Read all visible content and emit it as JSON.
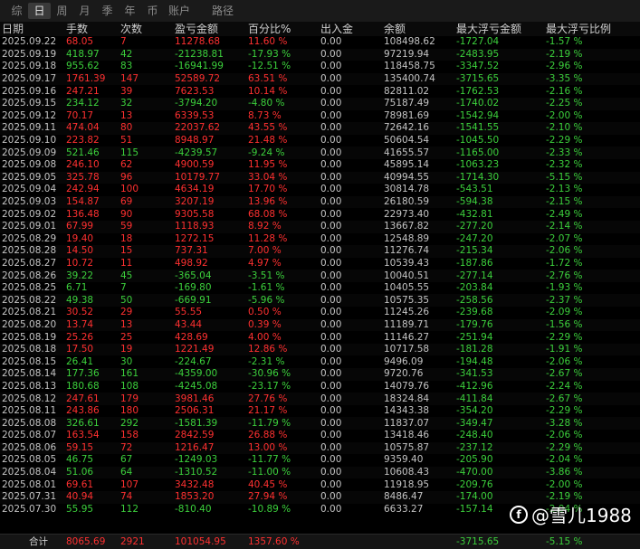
{
  "tabs": [
    {
      "label": "综",
      "active": false
    },
    {
      "label": "日",
      "active": true
    },
    {
      "label": "周",
      "active": false
    },
    {
      "label": "月",
      "active": false
    },
    {
      "label": "季",
      "active": false
    },
    {
      "label": "年",
      "active": false
    },
    {
      "label": "币",
      "active": false
    },
    {
      "label": "账户",
      "active": false
    },
    {
      "label": "路径",
      "active": false
    }
  ],
  "columns": [
    "日期",
    "手数",
    "次数",
    "盈亏金额",
    "百分比%",
    "出入金",
    "余额",
    "最大浮亏金额",
    "最大浮亏比例"
  ],
  "rows": [
    [
      "2025.09.22",
      "68.05",
      "7",
      "11278.68",
      "11.60 %",
      "0.00",
      "108498.62",
      "-1727.04",
      "-1.57 %"
    ],
    [
      "2025.09.19",
      "418.97",
      "42",
      "-21238.81",
      "-17.93 %",
      "0.00",
      "97219.94",
      "-2483.95",
      "-2.19 %"
    ],
    [
      "2025.09.18",
      "955.62",
      "83",
      "-16941.99",
      "-12.51 %",
      "0.00",
      "118458.75",
      "-3347.52",
      "-2.96 %"
    ],
    [
      "2025.09.17",
      "1761.39",
      "147",
      "52589.72",
      "63.51 %",
      "0.00",
      "135400.74",
      "-3715.65",
      "-3.35 %"
    ],
    [
      "2025.09.16",
      "247.21",
      "39",
      "7623.53",
      "10.14 %",
      "0.00",
      "82811.02",
      "-1762.53",
      "-2.16 %"
    ],
    [
      "2025.09.15",
      "234.12",
      "32",
      "-3794.20",
      "-4.80 %",
      "0.00",
      "75187.49",
      "-1740.02",
      "-2.25 %"
    ],
    [
      "2025.09.12",
      "70.17",
      "13",
      "6339.53",
      "8.73 %",
      "0.00",
      "78981.69",
      "-1542.94",
      "-2.00 %"
    ],
    [
      "2025.09.11",
      "474.04",
      "80",
      "22037.62",
      "43.55 %",
      "0.00",
      "72642.16",
      "-1541.55",
      "-2.10 %"
    ],
    [
      "2025.09.10",
      "223.82",
      "51",
      "8948.97",
      "21.48 %",
      "0.00",
      "50604.54",
      "-1045.50",
      "-2.29 %"
    ],
    [
      "2025.09.09",
      "521.46",
      "115",
      "-4239.57",
      "-9.24 %",
      "0.00",
      "41655.57",
      "-1165.00",
      "-2.33 %"
    ],
    [
      "2025.09.08",
      "246.10",
      "62",
      "4900.59",
      "11.95 %",
      "0.00",
      "45895.14",
      "-1063.23",
      "-2.32 %"
    ],
    [
      "2025.09.05",
      "325.78",
      "96",
      "10179.77",
      "33.04 %",
      "0.00",
      "40994.55",
      "-1714.30",
      "-5.15 %"
    ],
    [
      "2025.09.04",
      "242.94",
      "100",
      "4634.19",
      "17.70 %",
      "0.00",
      "30814.78",
      "-543.51",
      "-2.13 %"
    ],
    [
      "2025.09.03",
      "154.87",
      "69",
      "3207.19",
      "13.96 %",
      "0.00",
      "26180.59",
      "-594.38",
      "-2.15 %"
    ],
    [
      "2025.09.02",
      "136.48",
      "90",
      "9305.58",
      "68.08 %",
      "0.00",
      "22973.40",
      "-432.81",
      "-2.49 %"
    ],
    [
      "2025.09.01",
      "67.99",
      "59",
      "1118.93",
      "8.92 %",
      "0.00",
      "13667.82",
      "-277.20",
      "-2.14 %"
    ],
    [
      "2025.08.29",
      "19.40",
      "18",
      "1272.15",
      "11.28 %",
      "0.00",
      "12548.89",
      "-247.20",
      "-2.07 %"
    ],
    [
      "2025.08.28",
      "14.50",
      "15",
      "737.31",
      "7.00 %",
      "0.00",
      "11276.74",
      "-215.34",
      "-2.06 %"
    ],
    [
      "2025.08.27",
      "10.72",
      "11",
      "498.92",
      "4.97 %",
      "0.00",
      "10539.43",
      "-187.86",
      "-1.72 %"
    ],
    [
      "2025.08.26",
      "39.22",
      "45",
      "-365.04",
      "-3.51 %",
      "0.00",
      "10040.51",
      "-277.14",
      "-2.76 %"
    ],
    [
      "2025.08.25",
      "6.71",
      "7",
      "-169.80",
      "-1.61 %",
      "0.00",
      "10405.55",
      "-203.84",
      "-1.93 %"
    ],
    [
      "2025.08.22",
      "49.38",
      "50",
      "-669.91",
      "-5.96 %",
      "0.00",
      "10575.35",
      "-258.56",
      "-2.37 %"
    ],
    [
      "2025.08.21",
      "30.52",
      "29",
      "55.55",
      "0.50 %",
      "0.00",
      "11245.26",
      "-239.68",
      "-2.09 %"
    ],
    [
      "2025.08.20",
      "13.74",
      "13",
      "43.44",
      "0.39 %",
      "0.00",
      "11189.71",
      "-179.76",
      "-1.56 %"
    ],
    [
      "2025.08.19",
      "25.26",
      "25",
      "428.69",
      "4.00 %",
      "0.00",
      "11146.27",
      "-251.94",
      "-2.29 %"
    ],
    [
      "2025.08.18",
      "17.50",
      "19",
      "1221.49",
      "12.86 %",
      "0.00",
      "10717.58",
      "-181.28",
      "-1.91 %"
    ],
    [
      "2025.08.15",
      "26.41",
      "30",
      "-224.67",
      "-2.31 %",
      "0.00",
      "9496.09",
      "-194.48",
      "-2.06 %"
    ],
    [
      "2025.08.14",
      "177.36",
      "161",
      "-4359.00",
      "-30.96 %",
      "0.00",
      "9720.76",
      "-341.53",
      "-2.67 %"
    ],
    [
      "2025.08.13",
      "180.68",
      "108",
      "-4245.08",
      "-23.17 %",
      "0.00",
      "14079.76",
      "-412.96",
      "-2.24 %"
    ],
    [
      "2025.08.12",
      "247.61",
      "179",
      "3981.46",
      "27.76 %",
      "0.00",
      "18324.84",
      "-411.84",
      "-2.67 %"
    ],
    [
      "2025.08.11",
      "243.86",
      "180",
      "2506.31",
      "21.17 %",
      "0.00",
      "14343.38",
      "-354.20",
      "-2.29 %"
    ],
    [
      "2025.08.08",
      "326.61",
      "292",
      "-1581.39",
      "-11.79 %",
      "0.00",
      "11837.07",
      "-349.47",
      "-3.28 %"
    ],
    [
      "2025.08.07",
      "163.54",
      "158",
      "2842.59",
      "26.88 %",
      "0.00",
      "13418.46",
      "-248.40",
      "-2.06 %"
    ],
    [
      "2025.08.06",
      "59.15",
      "72",
      "1216.47",
      "13.00 %",
      "0.00",
      "10575.87",
      "-237.12",
      "-2.29 %"
    ],
    [
      "2025.08.05",
      "46.75",
      "67",
      "-1249.03",
      "-11.77 %",
      "0.00",
      "9359.40",
      "-205.90",
      "-2.04 %"
    ],
    [
      "2025.08.04",
      "51.06",
      "64",
      "-1310.52",
      "-11.00 %",
      "0.00",
      "10608.43",
      "-470.00",
      "-3.86 %"
    ],
    [
      "2025.08.01",
      "69.61",
      "107",
      "3432.48",
      "40.45 %",
      "0.00",
      "11918.95",
      "-209.76",
      "-2.00 %"
    ],
    [
      "2025.07.31",
      "40.94",
      "74",
      "1853.20",
      "27.94 %",
      "0.00",
      "8486.47",
      "-174.00",
      "-2.19 %"
    ],
    [
      "2025.07.30",
      "55.95",
      "112",
      "-810.40",
      "-10.89 %",
      "0.00",
      "6633.27",
      "-157.14",
      "-2.04 %"
    ]
  ],
  "total": {
    "label": "合计",
    "lots": "8065.69",
    "count": "2921",
    "pnl": "101054.95",
    "pct": "1357.60 %",
    "deposit": "",
    "balance": "",
    "max_float_loss": "-3715.65",
    "max_float_ratio": "-5.15 %"
  },
  "watermark": {
    "text": "@雪儿1988",
    "icon": "weibo-like-icon"
  },
  "colors": {
    "profit": "#ff3030",
    "loss": "#3cd03c",
    "text": "#c4c4c4",
    "background": "#000000"
  }
}
